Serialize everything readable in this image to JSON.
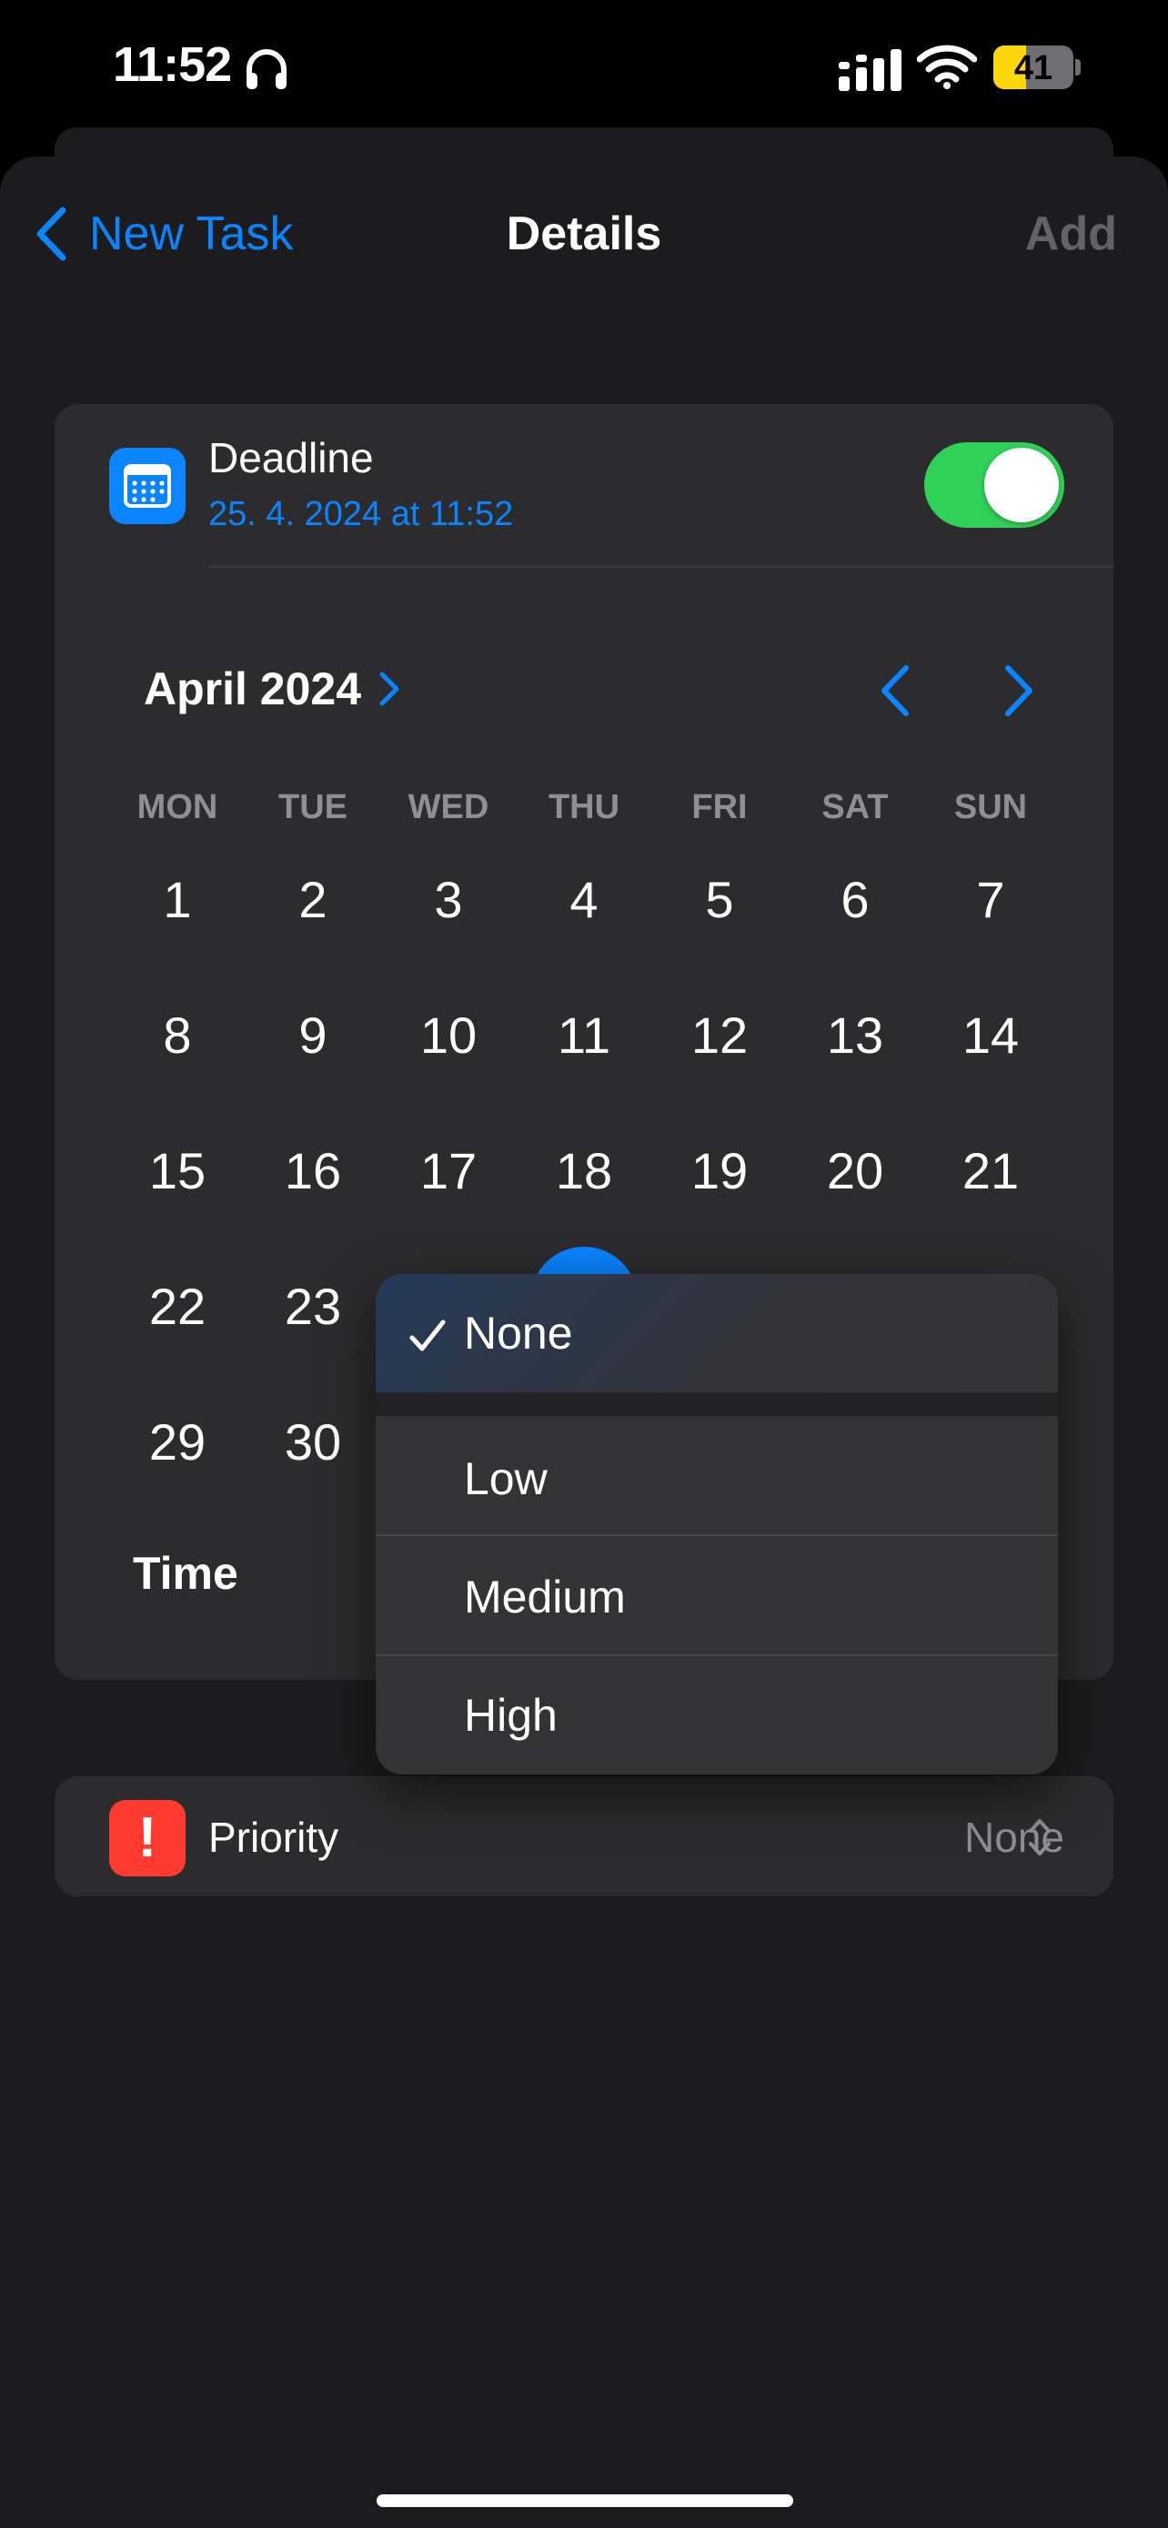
{
  "status_bar": {
    "time": "11:52",
    "battery": "41",
    "battery_level": 0.41
  },
  "nav": {
    "back_label": "New Task",
    "title": "Details",
    "add_label": "Add"
  },
  "deadline": {
    "label": "Deadline",
    "value": "25. 4. 2024 at 11:52",
    "enabled": true
  },
  "calendar": {
    "month_label": "April 2024",
    "weekdays": [
      "MON",
      "TUE",
      "WED",
      "THU",
      "FRI",
      "SAT",
      "SUN"
    ],
    "weeks": [
      [
        "1",
        "2",
        "3",
        "4",
        "5",
        "6",
        "7"
      ],
      [
        "8",
        "9",
        "10",
        "11",
        "12",
        "13",
        "14"
      ],
      [
        "15",
        "16",
        "17",
        "18",
        "19",
        "20",
        "21"
      ],
      [
        "22",
        "23"
      ],
      [
        "29",
        "30"
      ]
    ],
    "selected_day": "25"
  },
  "time": {
    "label": "Time"
  },
  "priority": {
    "label": "Priority",
    "value": "None",
    "icon_glyph": "!"
  },
  "priority_menu": {
    "items": [
      {
        "label": "None",
        "checked": true
      },
      {
        "label": "Low",
        "checked": false
      },
      {
        "label": "Medium",
        "checked": false
      },
      {
        "label": "High",
        "checked": false
      }
    ]
  },
  "colors": {
    "accent": "#0a84ff",
    "toggle_on": "#30d158",
    "priority_icon": "#ff3b30"
  },
  "icons": {
    "deadline": "calendar-icon",
    "priority": "exclamation-icon"
  }
}
